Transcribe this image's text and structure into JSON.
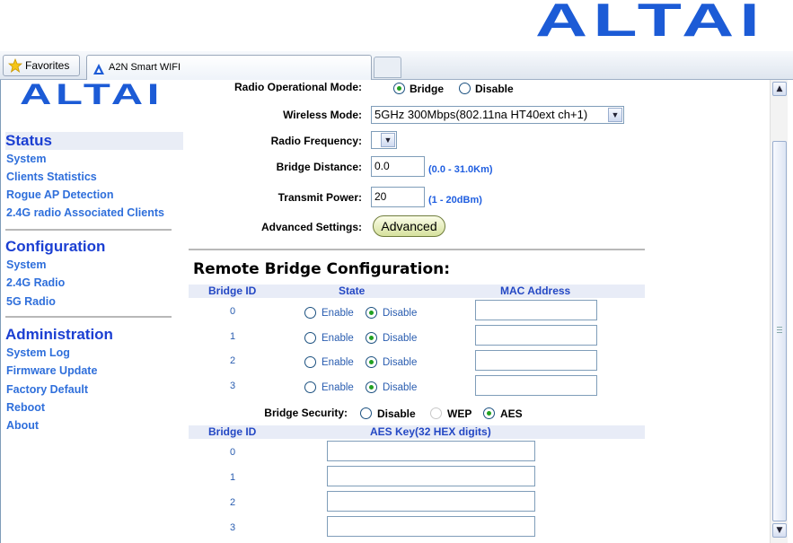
{
  "browser": {
    "favorites_label": "Favorites",
    "tab_title": "A2N Smart WIFI"
  },
  "brand": {
    "logo_text": "ALTAI",
    "logo_color": "#1c5bd6"
  },
  "nav": {
    "status_heading": "Status",
    "status_items": [
      "System",
      "Clients Statistics",
      "Rogue AP Detection",
      "2.4G radio Associated Clients"
    ],
    "config_heading": "Configuration",
    "config_items": [
      "System",
      "2.4G Radio",
      "5G Radio"
    ],
    "admin_heading": "Administration",
    "admin_items": [
      "System Log",
      "Firmware Update",
      "Factory Default",
      "Reboot",
      "About"
    ]
  },
  "form": {
    "radio_mode_label": "Radio Operational Mode:",
    "radio_mode_options": [
      "Bridge",
      "Disable"
    ],
    "radio_mode_selected": "Bridge",
    "wireless_mode_label": "Wireless Mode:",
    "wireless_mode_value": "5GHz 300Mbps(802.11na HT40ext ch+1)",
    "radio_freq_label": "Radio Frequency:",
    "radio_freq_value": "",
    "bridge_distance_label": "Bridge Distance:",
    "bridge_distance_value": "0.0",
    "bridge_distance_range": "(0.0 - 31.0Km)",
    "transmit_power_label": "Transmit Power:",
    "transmit_power_value": "20",
    "transmit_power_range": "(1 - 20dBm)",
    "advanced_label": "Advanced Settings:",
    "advanced_button": "Advanced"
  },
  "remote": {
    "title": "Remote Bridge Configuration:",
    "headers": {
      "bridge_id": "Bridge ID",
      "state": "State",
      "mac": "MAC Address"
    },
    "rows": [
      {
        "id": "0",
        "enable_label": "Enable",
        "disable_label": "Disable",
        "state": "Disable",
        "mac": ""
      },
      {
        "id": "1",
        "enable_label": "Enable",
        "disable_label": "Disable",
        "state": "Disable",
        "mac": ""
      },
      {
        "id": "2",
        "enable_label": "Enable",
        "disable_label": "Disable",
        "state": "Disable",
        "mac": ""
      },
      {
        "id": "3",
        "enable_label": "Enable",
        "disable_label": "Disable",
        "state": "Disable",
        "mac": ""
      }
    ],
    "security_label": "Bridge Security:",
    "security_options": [
      "Disable",
      "WEP",
      "AES"
    ],
    "security_selected": "AES",
    "aes_headers": {
      "bridge_id": "Bridge ID",
      "key": "AES Key(32 HEX digits)"
    },
    "aes_rows": [
      {
        "id": "0",
        "key": ""
      },
      {
        "id": "1",
        "key": ""
      },
      {
        "id": "2",
        "key": ""
      },
      {
        "id": "3",
        "key": ""
      }
    ]
  }
}
